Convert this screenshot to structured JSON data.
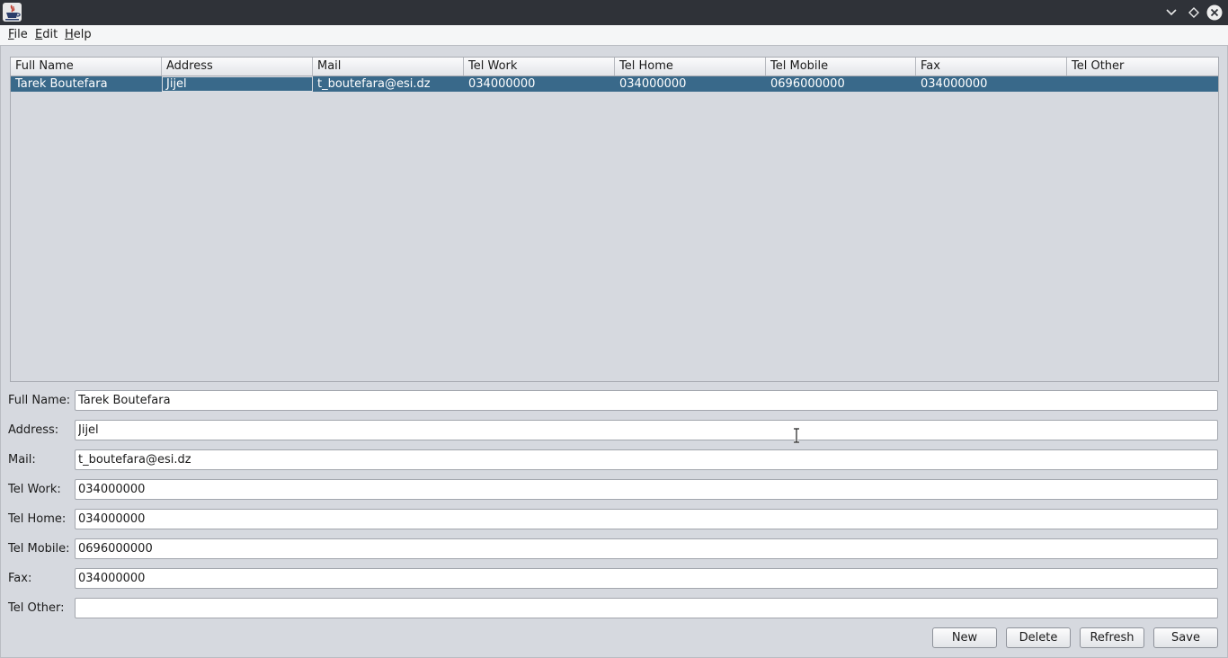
{
  "menu": {
    "items": [
      {
        "mnemonic": "F",
        "rest": "ile"
      },
      {
        "mnemonic": "E",
        "rest": "dit"
      },
      {
        "mnemonic": "H",
        "rest": "elp"
      }
    ]
  },
  "table": {
    "columns": [
      "Full Name",
      "Address",
      "Mail",
      "Tel Work",
      "Tel Home",
      "Tel Mobile",
      "Fax",
      "Tel Other"
    ],
    "rows": [
      [
        "Tarek Boutefara",
        "Jijel",
        "t_boutefara@esi.dz",
        "034000000",
        "034000000",
        "0696000000",
        "034000000",
        ""
      ]
    ]
  },
  "form": {
    "fields": [
      {
        "label": "Full Name:",
        "value": "Tarek Boutefara"
      },
      {
        "label": "Address:",
        "value": "Jijel"
      },
      {
        "label": "Mail:",
        "value": "t_boutefara@esi.dz"
      },
      {
        "label": "Tel Work:",
        "value": "034000000"
      },
      {
        "label": "Tel Home:",
        "value": "034000000"
      },
      {
        "label": "Tel Mobile:",
        "value": "0696000000"
      },
      {
        "label": "Fax:",
        "value": "034000000"
      },
      {
        "label": "Tel Other:",
        "value": ""
      }
    ]
  },
  "buttons": {
    "new_label": "New",
    "delete_label": "Delete",
    "refresh_label": "Refresh",
    "save_label": "Save"
  },
  "icons": {
    "app": "java-app-icon",
    "minimize": "chevron-down-icon",
    "maximize": "diamond-icon",
    "close": "close-circle-icon",
    "cursor": "text-cursor-icon"
  },
  "colors": {
    "titlebar": "#2f3238",
    "selection": "#39698a",
    "window_bg": "#d6d9df"
  }
}
